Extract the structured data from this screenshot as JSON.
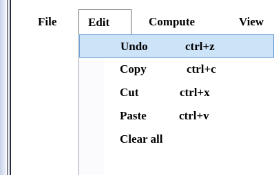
{
  "menubar": {
    "items": [
      {
        "label": "File"
      },
      {
        "label": "Edit"
      },
      {
        "label": "Compute"
      },
      {
        "label": "View"
      }
    ]
  },
  "edit_menu": {
    "items": [
      {
        "label": "Undo",
        "shortcut": "ctrl+z",
        "highlighted": true
      },
      {
        "label": "Copy",
        "shortcut": "ctrl+c"
      },
      {
        "label": "Cut",
        "shortcut": "ctrl+x"
      },
      {
        "label": "Paste",
        "shortcut": "ctrl+v"
      },
      {
        "label": "Clear all",
        "shortcut": ""
      }
    ]
  },
  "colors": {
    "highlight_fill": "#cde3f7",
    "highlight_border": "#6fa3d8"
  }
}
